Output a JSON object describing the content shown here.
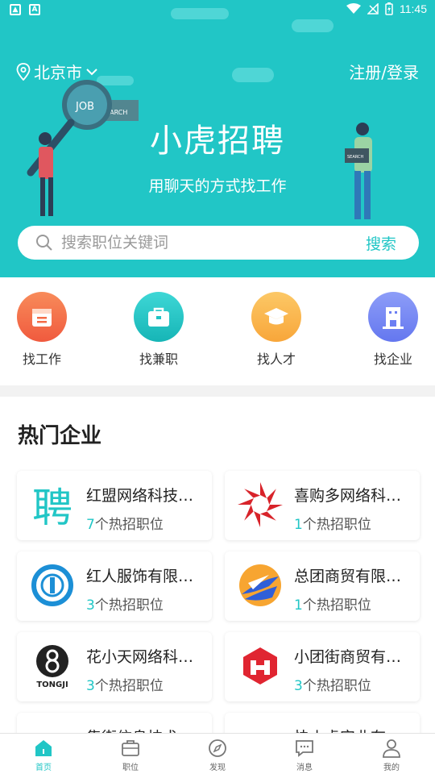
{
  "status_bar": {
    "time": "11:45"
  },
  "header": {
    "city": "北京市",
    "login": "注册/登录",
    "app_title": "小虎招聘",
    "subtitle": "用聊天的方式找工作",
    "illustration_text_1": "JOB",
    "illustration_text_2": "SEARCH"
  },
  "search": {
    "placeholder": "搜索职位关键词",
    "button": "搜索"
  },
  "entries": [
    {
      "label": "找工作",
      "color": "#f46c47"
    },
    {
      "label": "找兼职",
      "color": "#1fc3c4"
    },
    {
      "label": "找人才",
      "color": "#fbb34a"
    },
    {
      "label": "找企业",
      "color": "#6b7ef3"
    }
  ],
  "section": {
    "title": "热门企业"
  },
  "companies": [
    {
      "name": "红盟网络科技有限公司",
      "count": "7",
      "suffix": "个热招职位",
      "logo_text": "聘"
    },
    {
      "name": "喜购多网络科技有限公司",
      "count": "1",
      "suffix": "个热招职位"
    },
    {
      "name": "红人服饰有限公司",
      "count": "3",
      "suffix": "个热招职位"
    },
    {
      "name": "总团商贸有限公司",
      "count": "1",
      "suffix": "个热招职位"
    },
    {
      "name": "花小天网络科技有限公司",
      "count": "3",
      "suffix": "个热招职位",
      "logo_text": "TONGJI"
    },
    {
      "name": "小团街商贸有限公司",
      "count": "3",
      "suffix": "个热招职位"
    },
    {
      "name": "集街信息技术有限公司",
      "count": "",
      "suffix": ""
    },
    {
      "name": "快小虎实业有限公司",
      "count": "",
      "suffix": ""
    }
  ],
  "bottom_nav": [
    {
      "label": "首页",
      "icon": "home-icon",
      "active": true
    },
    {
      "label": "职位",
      "icon": "briefcase-icon",
      "active": false
    },
    {
      "label": "发现",
      "icon": "compass-icon",
      "active": false
    },
    {
      "label": "消息",
      "icon": "message-icon",
      "active": false
    },
    {
      "label": "我的",
      "icon": "user-icon",
      "active": false
    }
  ],
  "colors": {
    "primary": "#21c6c6",
    "text": "#222222"
  }
}
